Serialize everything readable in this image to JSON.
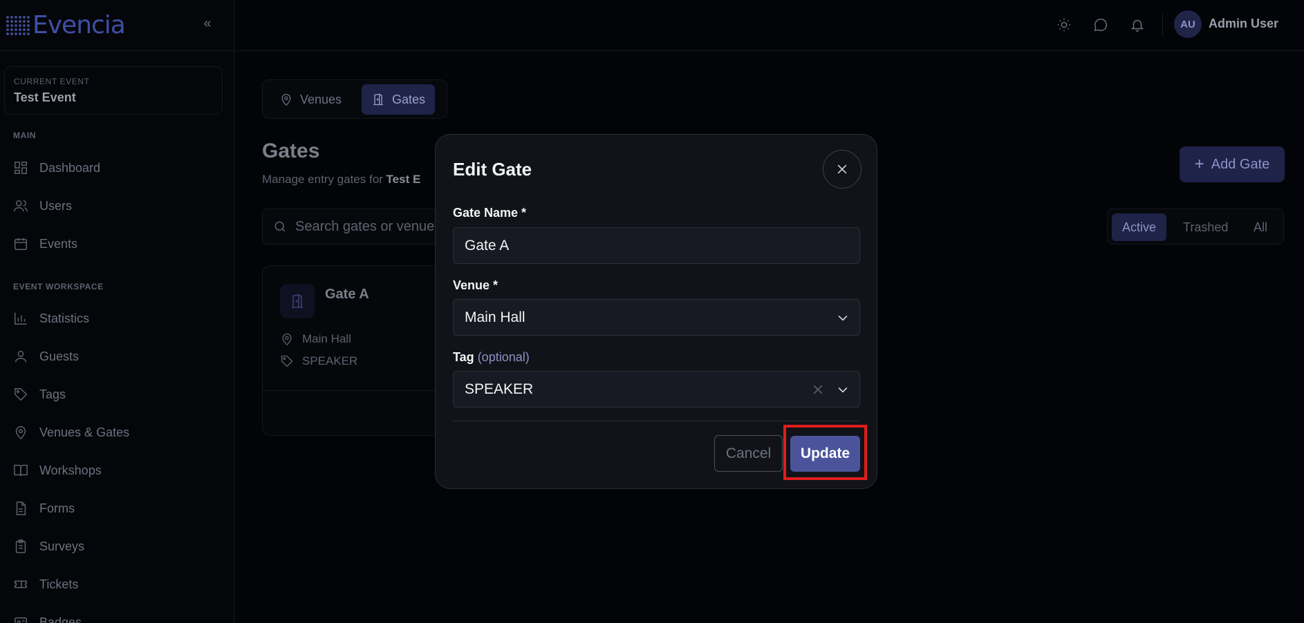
{
  "app": {
    "logo_text": "Evencia"
  },
  "topbar": {
    "avatar_initials": "AU",
    "user_name": "Admin User"
  },
  "sidebar": {
    "current_event_label": "CURRENT EVENT",
    "current_event_name": "Test Event",
    "section_main": "MAIN",
    "main_items": [
      {
        "label": "Dashboard",
        "icon": "dashboard-icon"
      },
      {
        "label": "Users",
        "icon": "users-icon"
      },
      {
        "label": "Events",
        "icon": "calendar-icon"
      }
    ],
    "section_workspace": "EVENT WORKSPACE",
    "workspace_items": [
      {
        "label": "Statistics",
        "icon": "bar-chart-icon"
      },
      {
        "label": "Guests",
        "icon": "user-icon"
      },
      {
        "label": "Tags",
        "icon": "tag-icon"
      },
      {
        "label": "Venues & Gates",
        "icon": "map-pin-icon"
      },
      {
        "label": "Workshops",
        "icon": "book-icon"
      },
      {
        "label": "Forms",
        "icon": "file-icon"
      },
      {
        "label": "Surveys",
        "icon": "clipboard-icon"
      },
      {
        "label": "Tickets",
        "icon": "ticket-icon"
      },
      {
        "label": "Badges",
        "icon": "badge-icon"
      }
    ]
  },
  "main": {
    "tabs": [
      {
        "label": "Venues"
      },
      {
        "label": "Gates"
      }
    ],
    "active_tab": "Gates",
    "title": "Gates",
    "subtitle_prefix": "Manage entry gates for ",
    "subtitle_event": "Test E",
    "add_button": "Add Gate",
    "search_placeholder": "Search gates or venue",
    "filters": [
      {
        "label": "Active"
      },
      {
        "label": "Trashed"
      },
      {
        "label": "All"
      }
    ],
    "active_filter": "Active",
    "gate_card": {
      "name": "Gate A",
      "venue": "Main Hall",
      "tag": "SPEAKER"
    }
  },
  "modal": {
    "title": "Edit Gate",
    "gate_name_label": "Gate Name *",
    "gate_name_value": "Gate A",
    "venue_label": "Venue *",
    "venue_value": "Main Hall",
    "tag_label": "Tag",
    "tag_optional": "(optional)",
    "tag_value": "SPEAKER",
    "cancel_label": "Cancel",
    "update_label": "Update"
  },
  "colors": {
    "accent": "#4b549b",
    "highlight": "#e01e1e",
    "background": "#030407",
    "modal_bg": "#111318"
  }
}
